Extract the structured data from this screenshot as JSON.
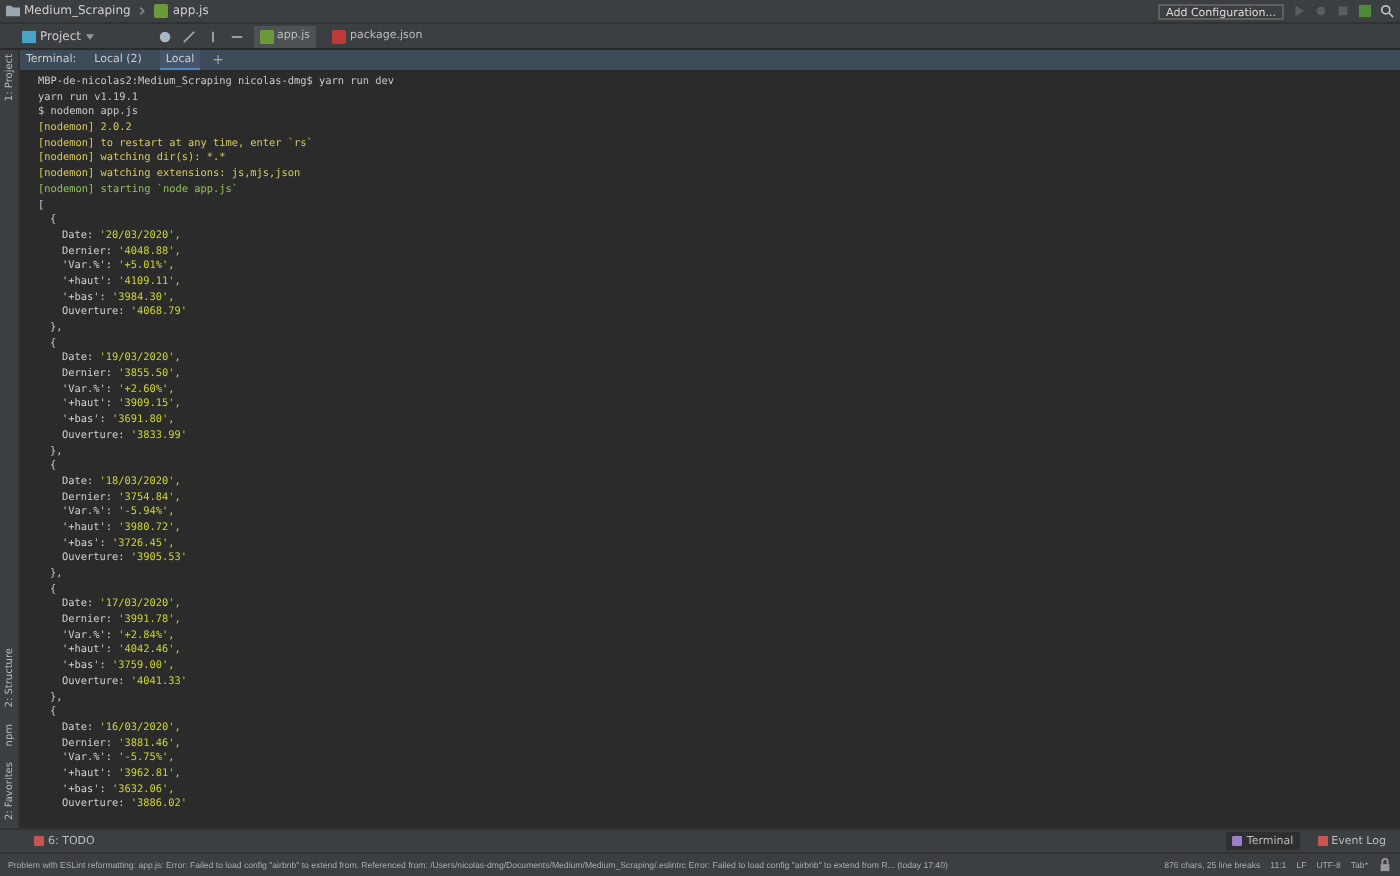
{
  "breadcrumb": [
    {
      "label": "Medium_Scraping",
      "kind": "folder"
    },
    {
      "label": "app.js",
      "kind": "js"
    }
  ],
  "run_config": {
    "label": "Add Configuration..."
  },
  "project_selector": {
    "label": "Project"
  },
  "editor_tabs": [
    {
      "label": "app.js",
      "kind": "js",
      "selected": true
    },
    {
      "label": "package.json",
      "kind": "json",
      "selected": false
    }
  ],
  "terminal_tabs": {
    "title": "Terminal:",
    "tabs": [
      {
        "label": "Local (2)",
        "selected": false
      },
      {
        "label": "Local",
        "selected": true
      }
    ],
    "add": "+"
  },
  "side_tools": {
    "top": [
      {
        "label": "1: Project"
      }
    ],
    "bottom": [
      {
        "label": "2: Structure"
      },
      {
        "label": "npm"
      },
      {
        "label": "2: Favorites"
      }
    ]
  },
  "terminal_lines": [
    {
      "kind": "plain",
      "text": "MBP-de-nicolas2:Medium_Scraping nicolas-dmg$ yarn run dev"
    },
    {
      "kind": "plain",
      "text": "yarn run v1.19.1"
    },
    {
      "kind": "plain",
      "text": "$ nodemon app.js"
    },
    {
      "kind": "nodemon",
      "text": "[nodemon] 2.0.2"
    },
    {
      "kind": "nodemon",
      "text": "[nodemon] to restart at any time, enter `rs`"
    },
    {
      "kind": "nodemon",
      "text": "[nodemon] watching dir(s): *.*"
    },
    {
      "kind": "nodemon",
      "text": "[nodemon] watching extensions: js,mjs,json"
    },
    {
      "kind": "start",
      "text": "[nodemon] starting `node app.js`"
    },
    {
      "kind": "plain",
      "text": "["
    }
  ],
  "records": [
    {
      "open": "{",
      "close": "},",
      "fields": [
        {
          "key": "Date:",
          "value": "'20/03/2020',"
        },
        {
          "key": "Dernier:",
          "value": "'4048.88',"
        },
        {
          "key": "'Var.%':",
          "value": "'+5.01%',"
        },
        {
          "key": "'+haut':",
          "value": "'4109.11',"
        },
        {
          "key": "'+bas':",
          "value": "'3984.30',"
        },
        {
          "key": "Ouverture:",
          "value": "'4068.79'"
        }
      ]
    },
    {
      "open": "{",
      "close": "},",
      "fields": [
        {
          "key": "Date:",
          "value": "'19/03/2020',"
        },
        {
          "key": "Dernier:",
          "value": "'3855.50',"
        },
        {
          "key": "'Var.%':",
          "value": "'+2.60%',"
        },
        {
          "key": "'+haut':",
          "value": "'3909.15',"
        },
        {
          "key": "'+bas':",
          "value": "'3691.80',"
        },
        {
          "key": "Ouverture:",
          "value": "'3833.99'"
        }
      ]
    },
    {
      "open": "{",
      "close": "},",
      "fields": [
        {
          "key": "Date:",
          "value": "'18/03/2020',"
        },
        {
          "key": "Dernier:",
          "value": "'3754.84',"
        },
        {
          "key": "'Var.%':",
          "value": "'-5.94%',"
        },
        {
          "key": "'+haut':",
          "value": "'3980.72',"
        },
        {
          "key": "'+bas':",
          "value": "'3726.45',"
        },
        {
          "key": "Ouverture:",
          "value": "'3905.53'"
        }
      ]
    },
    {
      "open": "{",
      "close": "},",
      "fields": [
        {
          "key": "Date:",
          "value": "'17/03/2020',"
        },
        {
          "key": "Dernier:",
          "value": "'3991.78',"
        },
        {
          "key": "'Var.%':",
          "value": "'+2.84%',"
        },
        {
          "key": "'+haut':",
          "value": "'4042.46',"
        },
        {
          "key": "'+bas':",
          "value": "'3759.00',"
        },
        {
          "key": "Ouverture:",
          "value": "'4041.33'"
        }
      ]
    },
    {
      "open": "{",
      "fields": [
        {
          "key": "Date:",
          "value": "'16/03/2020',"
        },
        {
          "key": "Dernier:",
          "value": "'3881.46',"
        },
        {
          "key": "'Var.%':",
          "value": "'-5.75%',"
        },
        {
          "key": "'+haut':",
          "value": "'3962.81',"
        },
        {
          "key": "'+bas':",
          "value": "'3632.06',"
        },
        {
          "key": "Ouverture:",
          "value": "'3886.02'"
        }
      ]
    }
  ],
  "tool_windows": {
    "left": [
      {
        "label": "6: TODO",
        "selected": false
      }
    ],
    "right": [
      {
        "label": "Terminal",
        "selected": true
      },
      {
        "label": "Event Log",
        "selected": false
      }
    ]
  },
  "status_bar": {
    "message": "Problem with ESLint reformatting: app.js: Error: Failed to load config \"airbnb\" to extend from. Referenced from: /Users/nicolas-dmg/Documents/Medium/Medium_Scraping/.eslintrc Error: Failed to load config \"airbnb\" to extend from R... (today 17:40)",
    "items": [
      "876 chars, 25 line breaks",
      "11:1",
      "LF",
      "UTF-8",
      "Tab*"
    ]
  }
}
